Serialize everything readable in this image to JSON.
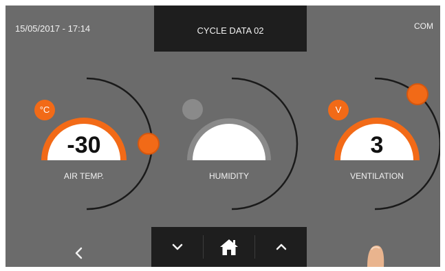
{
  "header": {
    "datetime": "15/05/2017 - 17:14",
    "title": "CYCLE DATA 02",
    "com_label": "COM"
  },
  "gauges": [
    {
      "label": "AIR TEMP.",
      "value": "-30",
      "unit": "°C",
      "active": true
    },
    {
      "label": "HUMIDITY",
      "value": "",
      "unit": "",
      "active": false
    },
    {
      "label": "VENTILATION",
      "value": "3",
      "unit": "V",
      "active": true
    }
  ],
  "nav": {
    "back_icon": "chevron-left-icon",
    "down_icon": "chevron-down-icon",
    "home_icon": "home-icon",
    "up_icon": "chevron-up-icon"
  },
  "colors": {
    "accent": "#f26a17",
    "screen_bg": "#6b6b6b",
    "panel_bg": "#1e1e1e",
    "status_dot": "#a6d23a"
  }
}
